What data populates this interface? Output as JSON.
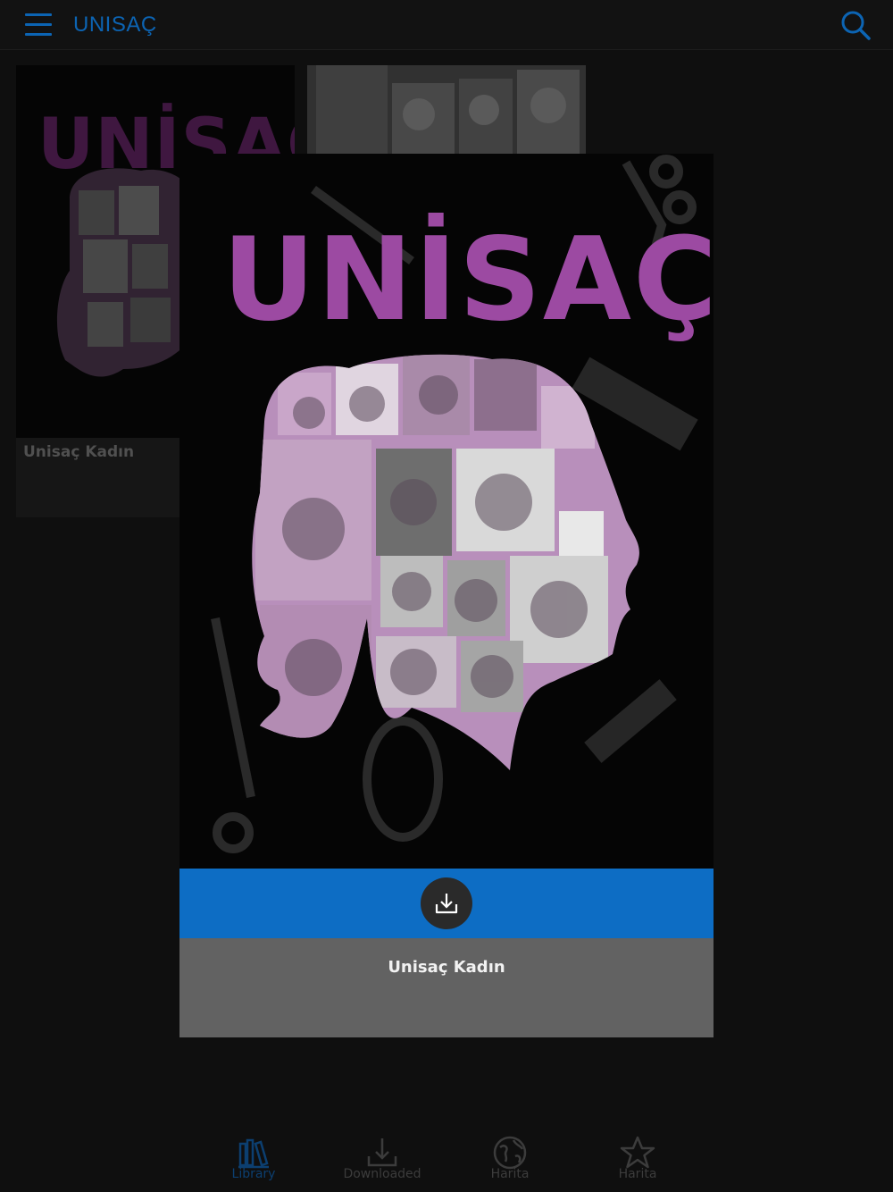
{
  "app": {
    "title": "UNISAÇ"
  },
  "library": {
    "cards": [
      {
        "title": "Unisaç Kadın",
        "cover_text": "UNİSAÇ"
      },
      {
        "title": ""
      }
    ]
  },
  "featured": {
    "cover_text": "UNİSAÇ",
    "title": "Unisaç Kadın"
  },
  "bottom_nav": {
    "items": [
      {
        "label": "Library",
        "icon": "library-icon",
        "active": true
      },
      {
        "label": "Downloaded",
        "icon": "download-tray-icon",
        "active": false
      },
      {
        "label": "Harita",
        "icon": "globe-icon",
        "active": false
      },
      {
        "label": "Harita",
        "icon": "star-icon",
        "active": false
      }
    ]
  },
  "colors": {
    "accent": "#0c64b3",
    "download_bar": "#0d6dc4",
    "brand_purple": "#9c4aa2",
    "background": "#121212"
  }
}
